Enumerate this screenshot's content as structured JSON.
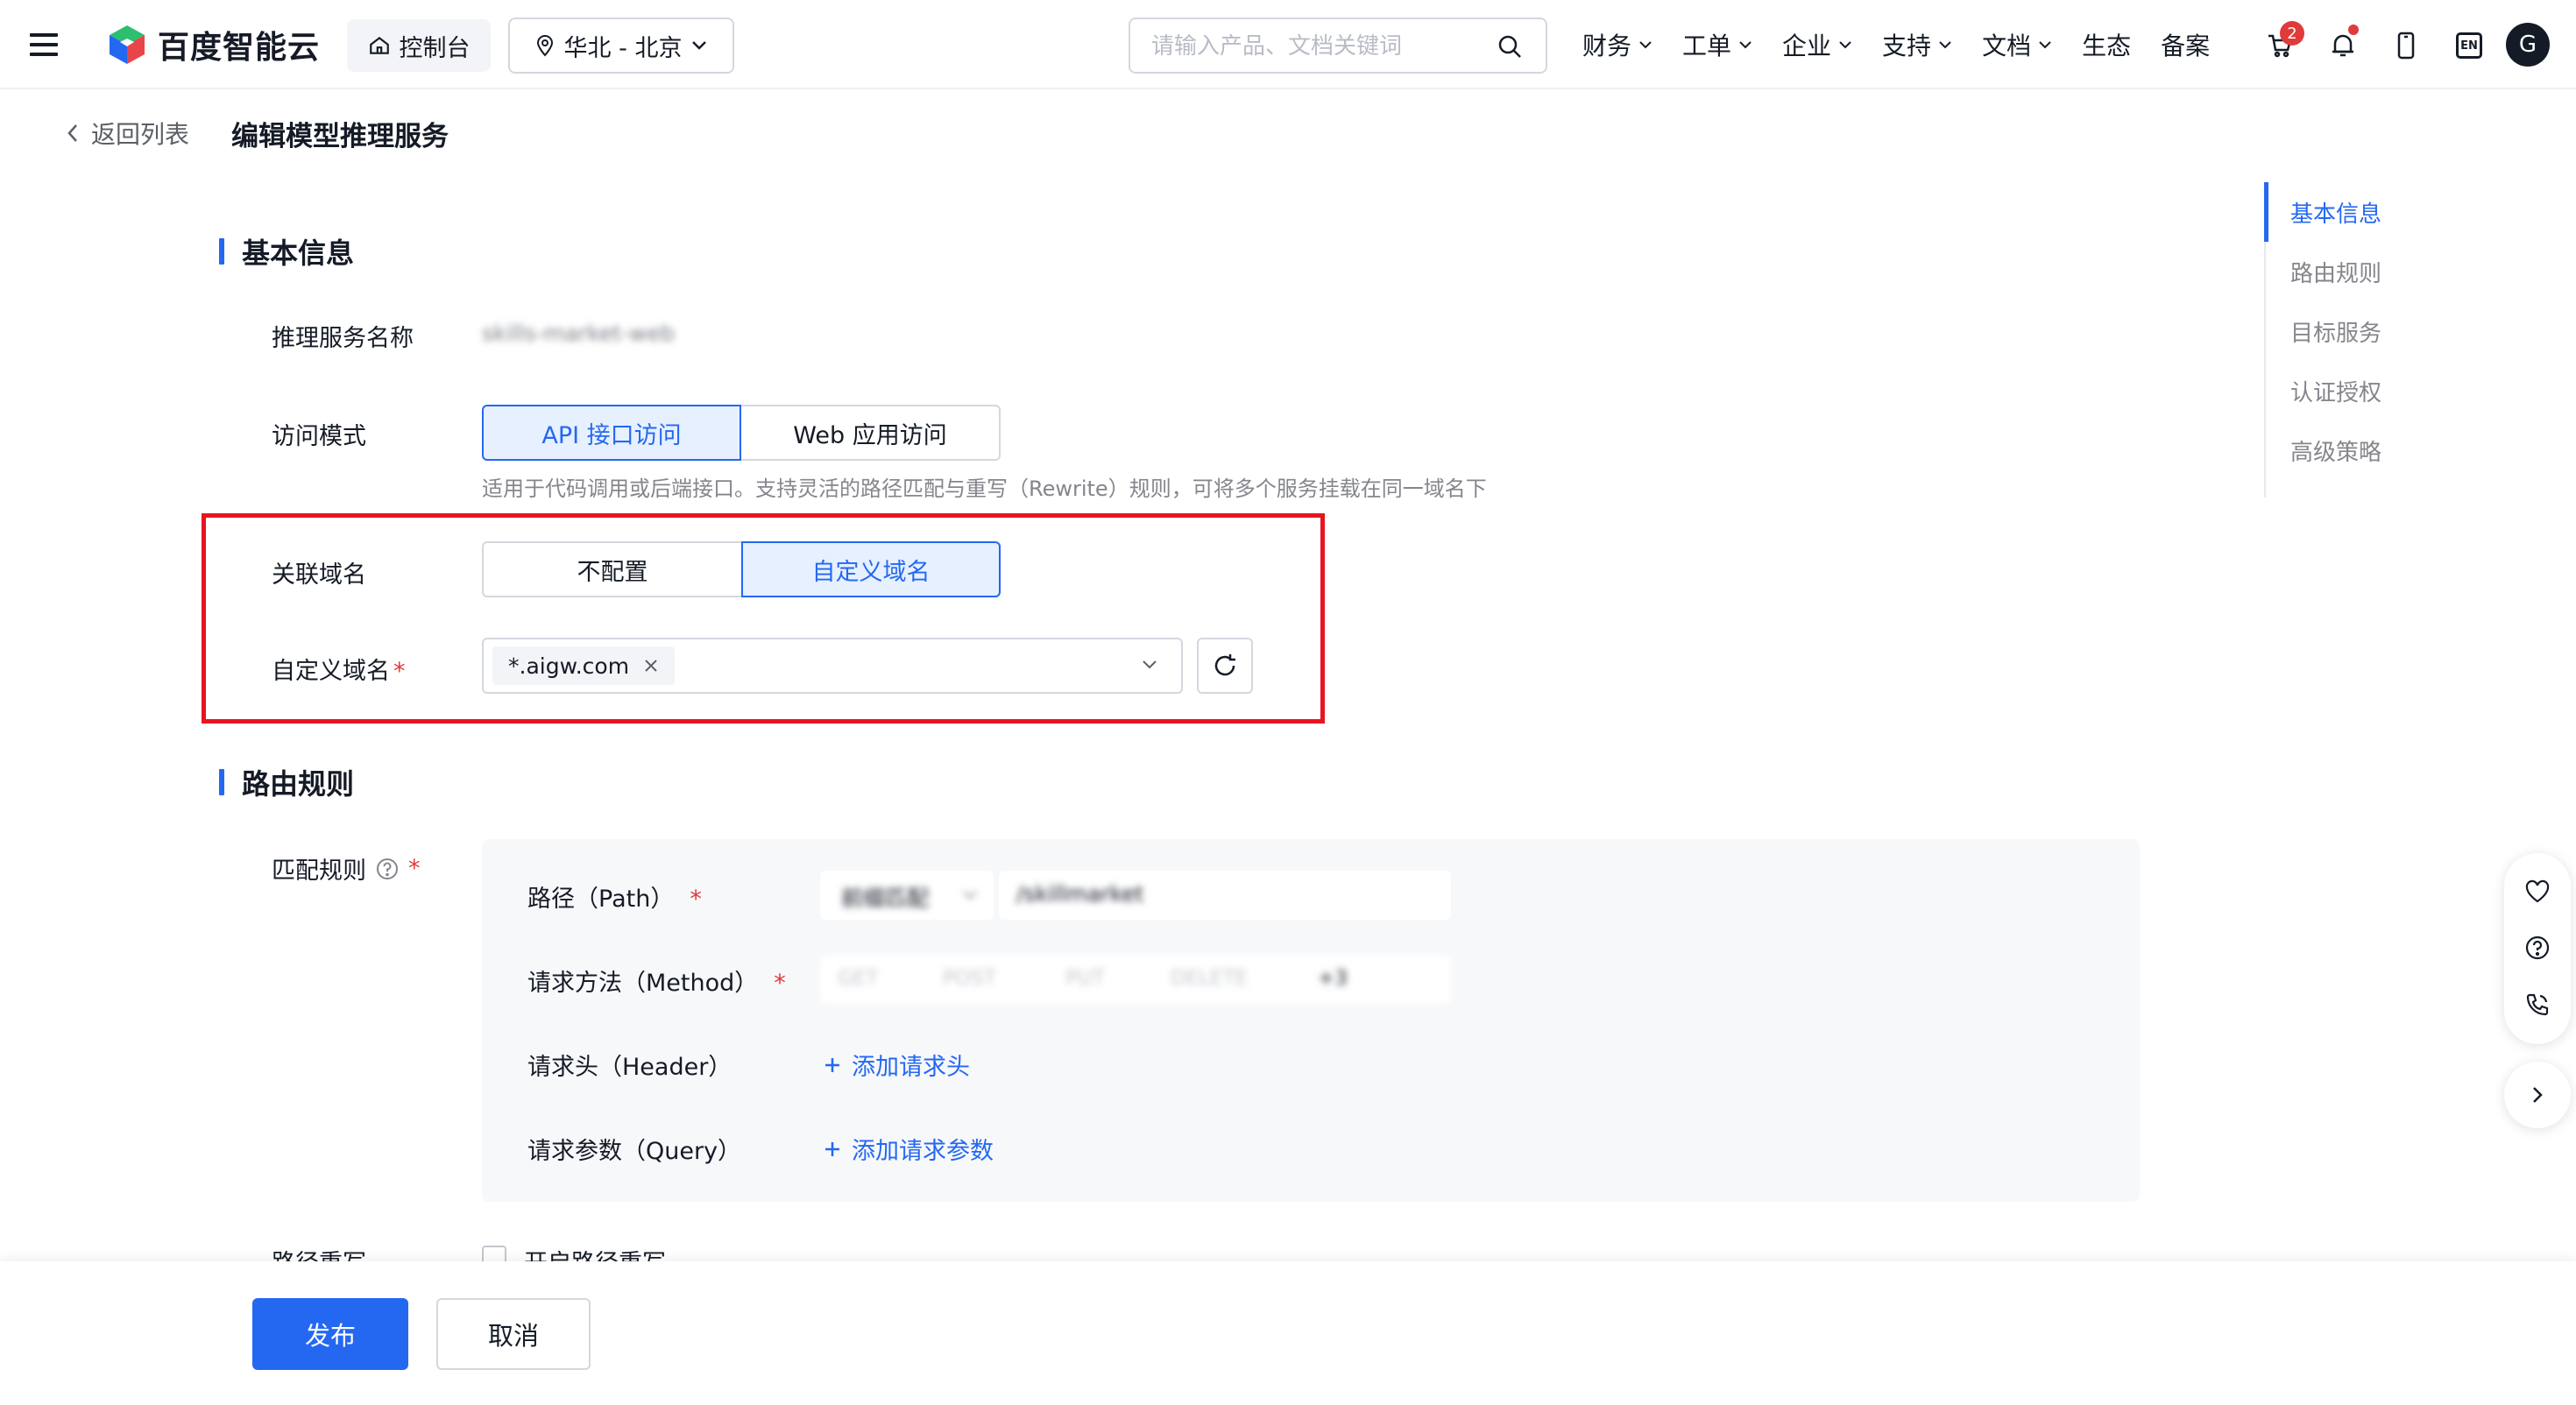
{
  "header": {
    "brand": "百度智能云",
    "console": "控制台",
    "region": "华北 - 北京",
    "search_placeholder": "请输入产品、文档关键词",
    "menu": [
      {
        "label": "财务",
        "dropdown": true
      },
      {
        "label": "工单",
        "dropdown": true
      },
      {
        "label": "企业",
        "dropdown": true
      },
      {
        "label": "支持",
        "dropdown": true
      },
      {
        "label": "文档",
        "dropdown": true
      },
      {
        "label": "生态",
        "dropdown": false
      },
      {
        "label": "备案",
        "dropdown": false
      }
    ],
    "cart_count": "2",
    "lang": "EN",
    "avatar": "G"
  },
  "page": {
    "back": "返回列表",
    "title": "编辑模型推理服务"
  },
  "basic": {
    "title": "基本信息",
    "service_name_label": "推理服务名称",
    "service_name_value": "skills-market-web",
    "access_mode_label": "访问模式",
    "access_modes": [
      "API 接口访问",
      "Web 应用访问"
    ],
    "access_hint": "适用于代码调用或后端接口。支持灵活的路径匹配与重写（Rewrite）规则，可将多个服务挂载在同一域名下",
    "domain_label": "关联域名",
    "domain_options": [
      "不配置",
      "自定义域名"
    ],
    "custom_domain_label": "自定义域名",
    "custom_domain_tag": "*.aigw.com"
  },
  "routing": {
    "title": "路由规则",
    "match_label": "匹配规则",
    "path_label": "路径（Path）",
    "path_match_type": "前缀匹配",
    "path_value": "/skillmarket",
    "method_label": "请求方法（Method）",
    "methods": [
      "GET",
      "POST",
      "PUT",
      "DELETE"
    ],
    "methods_more": "+3",
    "header_label": "请求头（Header）",
    "add_header": "添加请求头",
    "query_label": "请求参数（Query）",
    "add_query": "添加请求参数",
    "rewrite_label": "路径重写",
    "rewrite_checkbox": "开启路径重写"
  },
  "anchors": [
    "基本信息",
    "路由规则",
    "目标服务",
    "认证授权",
    "高级策略"
  ],
  "actions": {
    "publish": "发布",
    "cancel": "取消"
  },
  "colors": {
    "primary": "#2468f2",
    "highlight": "#e8141e",
    "required": "#e03a3a"
  }
}
